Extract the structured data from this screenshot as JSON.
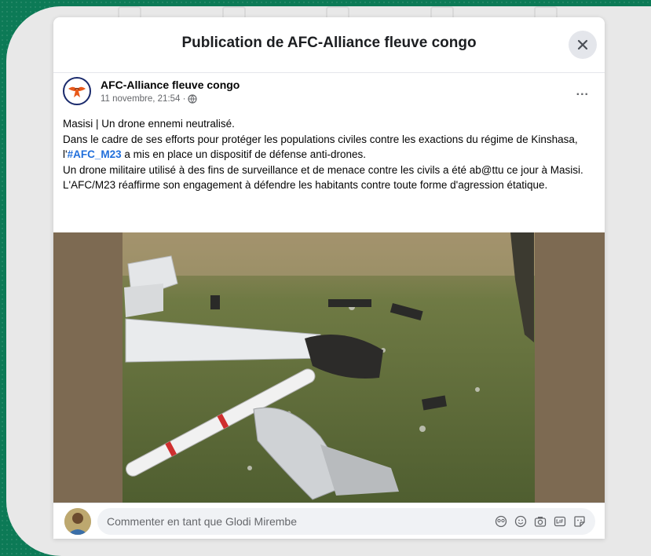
{
  "dialog": {
    "title": "Publication de AFC-Alliance fleuve congo",
    "close_icon": "close-icon"
  },
  "post": {
    "page_name": "AFC-Alliance fleuve congo",
    "timestamp": "11 novembre, 21:54 ·",
    "audience_icon": "globe-icon",
    "more_icon": "more-options-icon",
    "more_label": "...",
    "text": {
      "line1": "Masisi | Un drone ennemi neutralisé.",
      "line2_before": "Dans le cadre de ses efforts pour protéger les populations civiles contre les exactions du régime de Kinshasa, l'",
      "hashtag": "#AFC_M23",
      "line2_after": " a mis en place un dispositif de défense anti-drones.",
      "line3": "Un drone militaire utilisé à des fins de surveillance et de menace contre les civils a été ab@ttu ce jour à Masisi.",
      "line4": "L'AFC/M23 réaffirme son engagement à défendre les habitants contre toute forme d'agression étatique."
    },
    "photo_subject": "drone-wreckage-photo"
  },
  "comment": {
    "placeholder": "Commenter en tant que Glodi Mirembe",
    "icons": [
      "avatar-sticker-icon",
      "emoji-icon",
      "camera-icon",
      "gif-icon",
      "sticker-icon"
    ]
  },
  "colors": {
    "accent": "#216fdb",
    "background_green": "#0c7a56",
    "brand_orange": "#e8591a"
  }
}
